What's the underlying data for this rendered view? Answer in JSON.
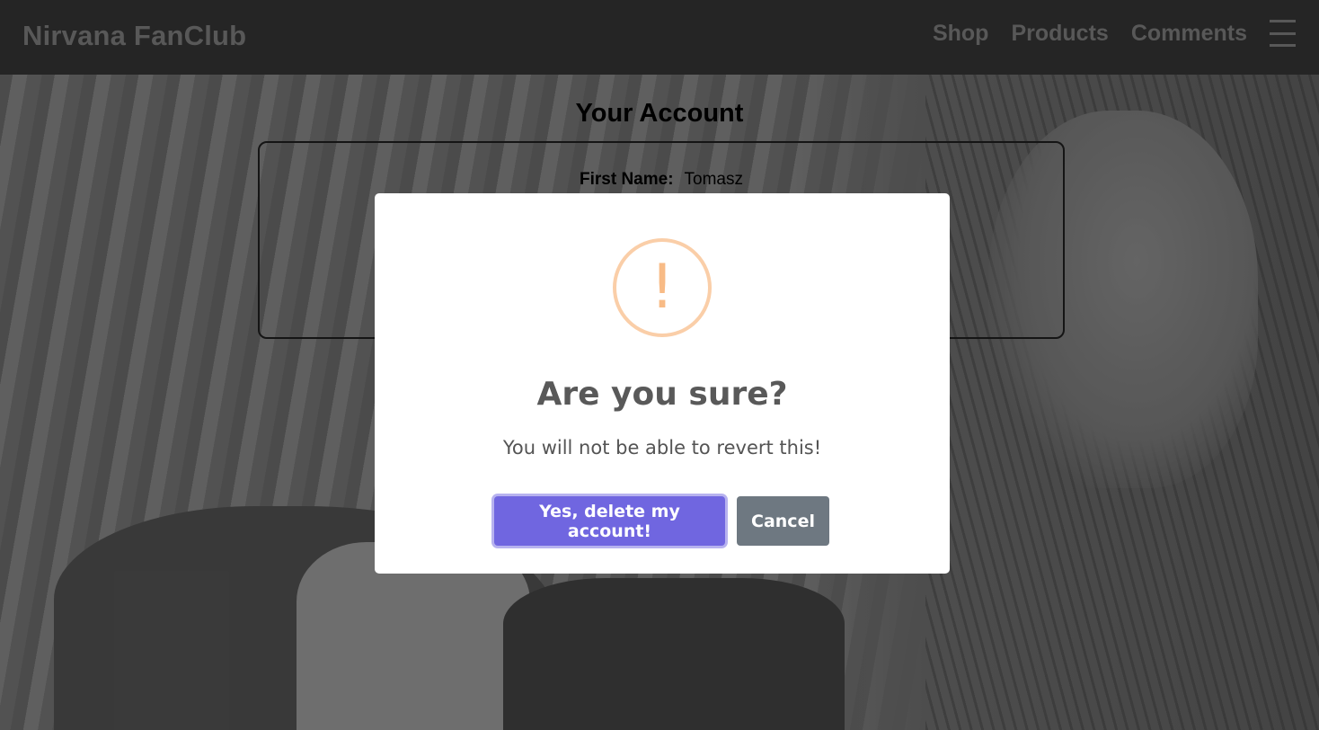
{
  "navbar": {
    "brand": "Nirvana FanClub",
    "links": [
      "Shop",
      "Products",
      "Comments"
    ],
    "menu_icon": "hamburger-menu-icon"
  },
  "account": {
    "title": "Your Account",
    "first_name_label": "First Name:",
    "first_name_value": "Tomasz"
  },
  "dialog": {
    "icon": "warning-icon",
    "icon_glyph": "!",
    "title": "Are you sure?",
    "text": "You will not be able to revert this!",
    "confirm_label": "Yes, delete my account!",
    "cancel_label": "Cancel",
    "colors": {
      "confirm": "#7066e0",
      "cancel": "#6e7881",
      "warning": "#f8bb86"
    }
  }
}
